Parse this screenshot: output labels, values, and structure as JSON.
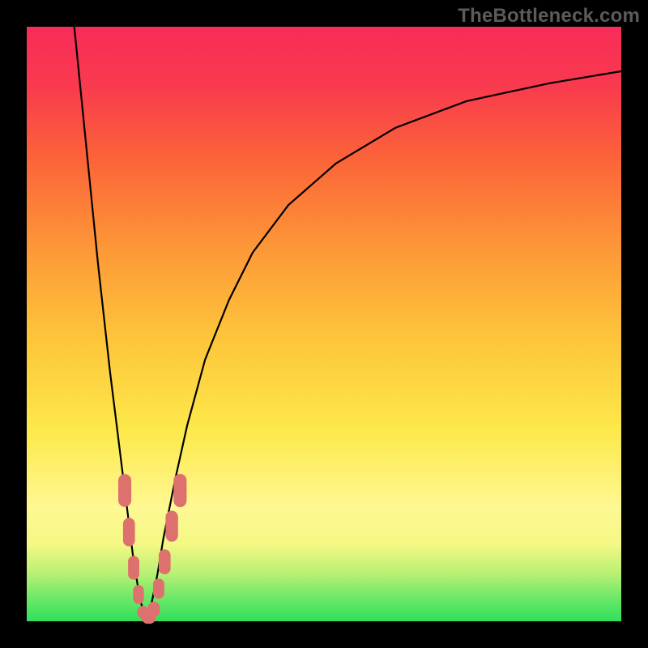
{
  "watermark": {
    "text": "TheBottleneck.com"
  },
  "colors": {
    "frame": "#000000",
    "gradient": [
      "#2fe05c",
      "#fef893",
      "#fdc43a",
      "#fb6339",
      "#f72c58"
    ],
    "curve": "#000000",
    "marker": "#dd716e"
  },
  "chart_data": {
    "type": "line",
    "title": "",
    "xlabel": "",
    "ylabel": "",
    "xlim": [
      0,
      100
    ],
    "ylim": [
      0,
      100
    ],
    "grid": false,
    "legend": false,
    "series": [
      {
        "name": "bottleneck-curve",
        "x": [
          8,
          10,
          12,
          14,
          15,
          16,
          17,
          18,
          19,
          20,
          21,
          22,
          23,
          25,
          27,
          30,
          34,
          38,
          44,
          52,
          62,
          74,
          88,
          100
        ],
        "y": [
          100,
          80,
          60,
          42,
          34,
          26,
          18,
          10,
          4,
          0,
          3,
          8,
          14,
          24,
          33,
          44,
          54,
          62,
          70,
          77,
          83,
          87.5,
          90.5,
          92.5
        ]
      }
    ],
    "markers": {
      "name": "highlighted-points",
      "type": "pill",
      "points": [
        {
          "x": 16.5,
          "y": 22,
          "w": 2.2,
          "h": 5.5
        },
        {
          "x": 17.2,
          "y": 15,
          "w": 2.0,
          "h": 4.8
        },
        {
          "x": 18.0,
          "y": 9,
          "w": 1.9,
          "h": 4.0
        },
        {
          "x": 18.8,
          "y": 4.5,
          "w": 1.8,
          "h": 3.2
        },
        {
          "x": 19.6,
          "y": 1.5,
          "w": 2.0,
          "h": 2.2
        },
        {
          "x": 20.5,
          "y": 0.6,
          "w": 2.4,
          "h": 2.0
        },
        {
          "x": 21.4,
          "y": 2.0,
          "w": 2.0,
          "h": 2.6
        },
        {
          "x": 22.2,
          "y": 5.5,
          "w": 1.9,
          "h": 3.4
        },
        {
          "x": 23.2,
          "y": 10,
          "w": 2.0,
          "h": 4.2
        },
        {
          "x": 24.4,
          "y": 16,
          "w": 2.1,
          "h": 5.2
        },
        {
          "x": 25.8,
          "y": 22,
          "w": 2.2,
          "h": 5.6
        }
      ]
    }
  }
}
